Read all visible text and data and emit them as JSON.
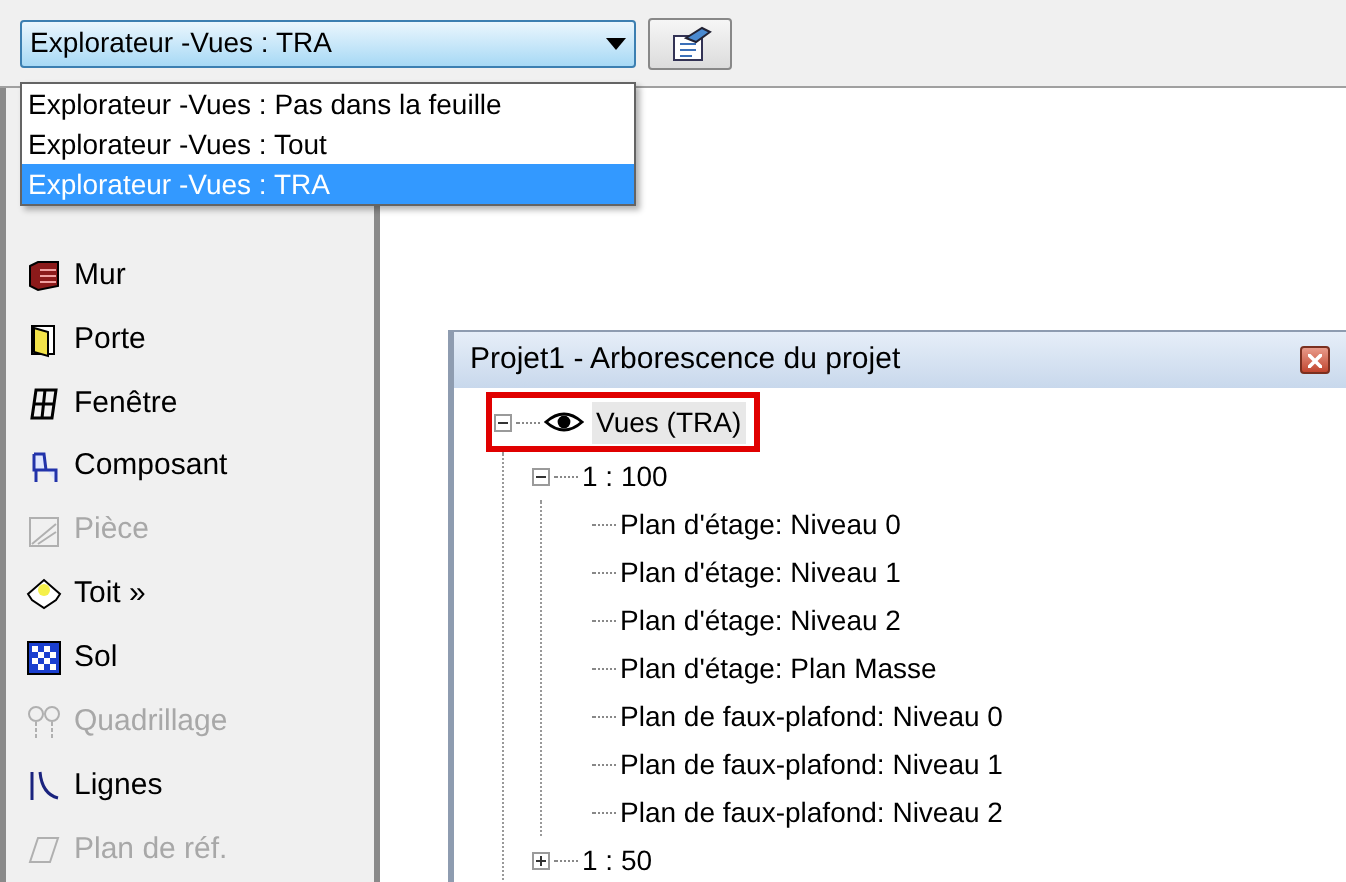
{
  "view_selector": {
    "value": "Explorateur -Vues : TRA",
    "open": true,
    "options": [
      {
        "label": "Explorateur -Vues : Pas dans la feuille",
        "selected": false
      },
      {
        "label": "Explorateur -Vues : Tout",
        "selected": false
      },
      {
        "label": "Explorateur -Vues : TRA",
        "selected": true
      }
    ]
  },
  "tools": [
    {
      "label": "Mur",
      "kind": "wall",
      "disabled": false
    },
    {
      "label": "Porte",
      "kind": "door",
      "disabled": false
    },
    {
      "label": "Fenêtre",
      "kind": "window",
      "disabled": false
    },
    {
      "label": "Composant",
      "kind": "component",
      "disabled": false
    },
    {
      "label": "Pièce",
      "kind": "room",
      "disabled": true
    },
    {
      "label": "Toit »",
      "kind": "roof",
      "disabled": false
    },
    {
      "label": "Sol",
      "kind": "floor",
      "disabled": false
    },
    {
      "label": "Quadrillage",
      "kind": "grid",
      "disabled": true
    },
    {
      "label": "Lignes",
      "kind": "lines",
      "disabled": false
    },
    {
      "label": "Plan de réf.",
      "kind": "plane",
      "disabled": true
    }
  ],
  "project_browser": {
    "title": "Projet1 - Arborescence du projet",
    "tree": [
      {
        "label": "Vues (TRA)",
        "expanded": true,
        "outlined": true,
        "children": [
          {
            "label": "1 : 100",
            "expanded": true,
            "children": [
              {
                "label": "Plan d'étage: Niveau 0"
              },
              {
                "label": "Plan d'étage: Niveau 1"
              },
              {
                "label": "Plan d'étage: Niveau 2"
              },
              {
                "label": "Plan d'étage: Plan Masse"
              },
              {
                "label": "Plan de faux-plafond: Niveau 0"
              },
              {
                "label": "Plan de faux-plafond: Niveau 1"
              },
              {
                "label": "Plan de faux-plafond: Niveau 2"
              }
            ]
          },
          {
            "label": "1 : 50",
            "expanded": false
          }
        ]
      }
    ]
  }
}
